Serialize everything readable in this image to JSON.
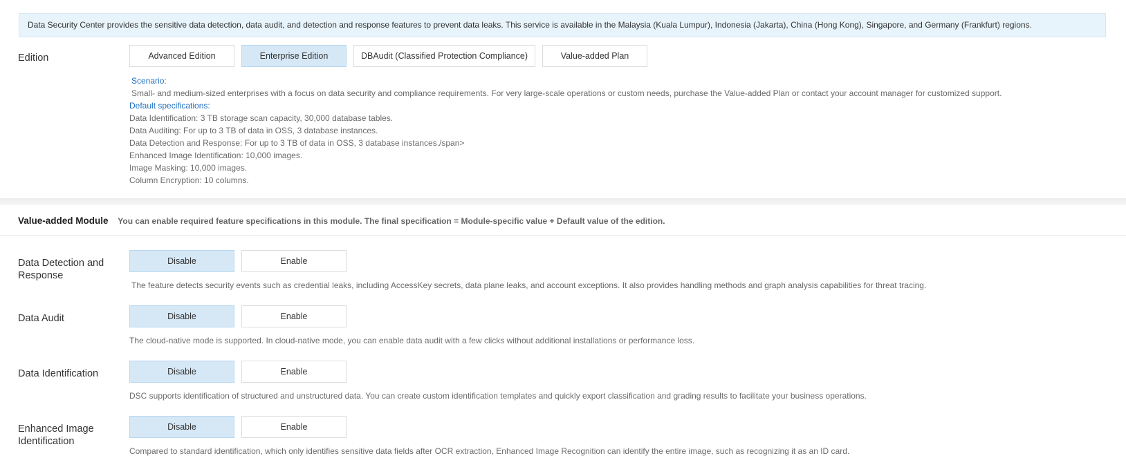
{
  "notice": {
    "text": "Data Security Center provides the sensitive data detection, data audit, and detection and response features to prevent data leaks. This service is available in the Malaysia (Kuala Lumpur), Indonesia (Jakarta), China (Hong Kong), Singapore, and Germany (Frankfurt) regions."
  },
  "edition": {
    "label": "Edition",
    "options": [
      "Advanced Edition",
      "Enterprise Edition",
      "DBAudit (Classified Protection Compliance)",
      "Value-added Plan"
    ],
    "selected": "Enterprise Edition",
    "scenario_heading": "Scenario:",
    "scenario_text": "Small- and medium-sized enterprises with a focus on data security and compliance requirements. For very large-scale operations or custom needs, purchase the Value-added Plan or contact your account manager for customized support.",
    "specs_heading": "Default specifications:",
    "specs": [
      "Data Identification: 3 TB  storage scan capacity, 30,000 database tables.",
      "Data Auditing: For up to 3 TB of data in OSS, 3 database instances.",
      "Data Detection and Response: For up to 3 TB  of data in OSS, 3 database instances./span>",
      "Enhanced Image Identification: 10,000 images.",
      "Image Masking: 10,000 images.",
      "Column Encryption: 10 columns."
    ]
  },
  "module": {
    "title": "Value-added Module",
    "subtitle": "You can enable required feature specifications in this module. The final specification = Module-specific value + Default value of the edition.",
    "disable_label": "Disable",
    "enable_label": "Enable",
    "rows": [
      {
        "label": "Data Detection and Response",
        "selected": "Disable",
        "description": "The feature detects security events such as credential leaks, including AccessKey secrets, data plane leaks, and account exceptions. It also provides handling methods and graph analysis capabilities for threat tracing."
      },
      {
        "label": "Data Audit",
        "selected": "Disable",
        "description": "The cloud-native mode is supported. In cloud-native mode, you can enable data audit with a few clicks without additional installations or performance loss."
      },
      {
        "label": "Data Identification",
        "selected": "Disable",
        "description": "DSC supports identification of structured and unstructured data. You can create custom identification templates and quickly export classification and grading results to facilitate your business operations."
      },
      {
        "label": "Enhanced Image Identification",
        "selected": "Disable",
        "description": "Compared to standard identification, which only identifies sensitive data fields after OCR extraction, Enhanced Image Recognition can identify the entire image, such as recognizing it as an ID card."
      }
    ]
  },
  "colors": {
    "notice_bg": "#e8f4fb",
    "active_bg": "#d6e8f6",
    "link": "#1f6fc0"
  }
}
